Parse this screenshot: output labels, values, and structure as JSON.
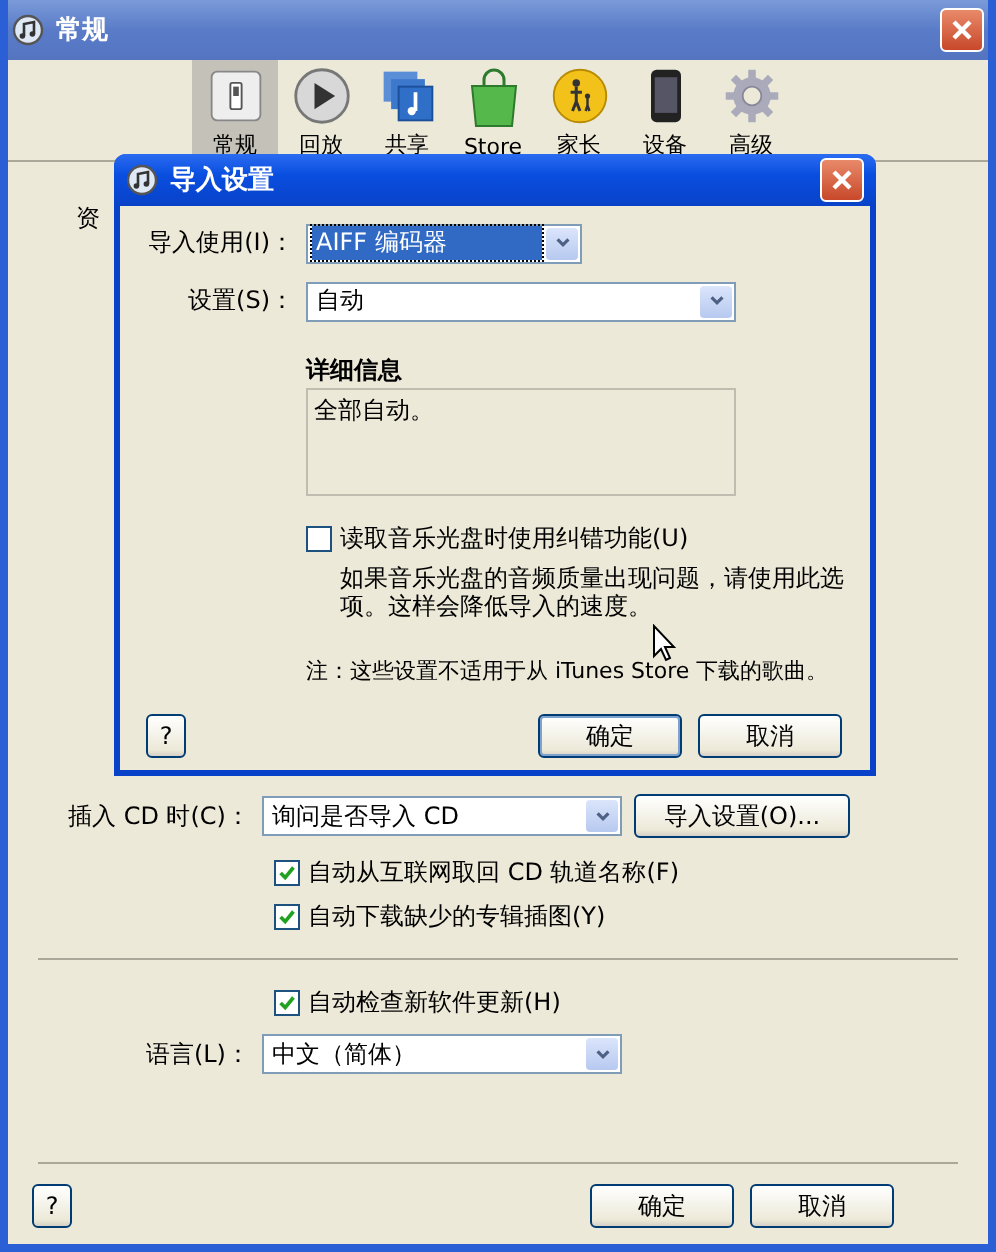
{
  "window": {
    "title": "常规"
  },
  "tabs": [
    {
      "label": "常规",
      "kind": "general",
      "selected": true
    },
    {
      "label": "回放",
      "kind": "playback",
      "selected": false
    },
    {
      "label": "共享",
      "kind": "sharing",
      "selected": false
    },
    {
      "label": "Store",
      "kind": "store",
      "selected": false
    },
    {
      "label": "家长",
      "kind": "parental",
      "selected": false
    },
    {
      "label": "设备",
      "kind": "devices",
      "selected": false
    },
    {
      "label": "高级",
      "kind": "advanced",
      "selected": false
    }
  ],
  "partial_label": "资",
  "cd_row": {
    "label": "插入 CD 时(C)：",
    "value": "询问是否导入 CD",
    "button": "导入设置(O)..."
  },
  "cd_options": [
    {
      "label": "自动从互联网取回 CD 轨道名称(F)",
      "checked": true
    },
    {
      "label": "自动下载缺少的专辑插图(Y)",
      "checked": true
    }
  ],
  "update_option": {
    "label": "自动检查新软件更新(H)",
    "checked": true
  },
  "language": {
    "label": "语言(L)：",
    "value": "中文（简体）"
  },
  "buttons": {
    "help": "?",
    "ok": "确定",
    "cancel": "取消"
  },
  "dialog": {
    "title": "导入设置",
    "import_using": {
      "label": "导入使用(I)：",
      "value": "AIFF 编码器",
      "focused": true
    },
    "setting": {
      "label": "设置(S)：",
      "value": "自动"
    },
    "details": {
      "heading": "详细信息",
      "text": "全部自动。"
    },
    "error_correction": {
      "label": "读取音乐光盘时使用纠错功能(U)",
      "checked": false
    },
    "hint": "如果音乐光盘的音频质量出现问题，请使用此选项。这样会降低导入的速度。",
    "note": "注：这些设置不适用于从 iTunes Store 下载的歌曲。",
    "buttons": {
      "help": "?",
      "ok": "确定",
      "cancel": "取消"
    }
  }
}
